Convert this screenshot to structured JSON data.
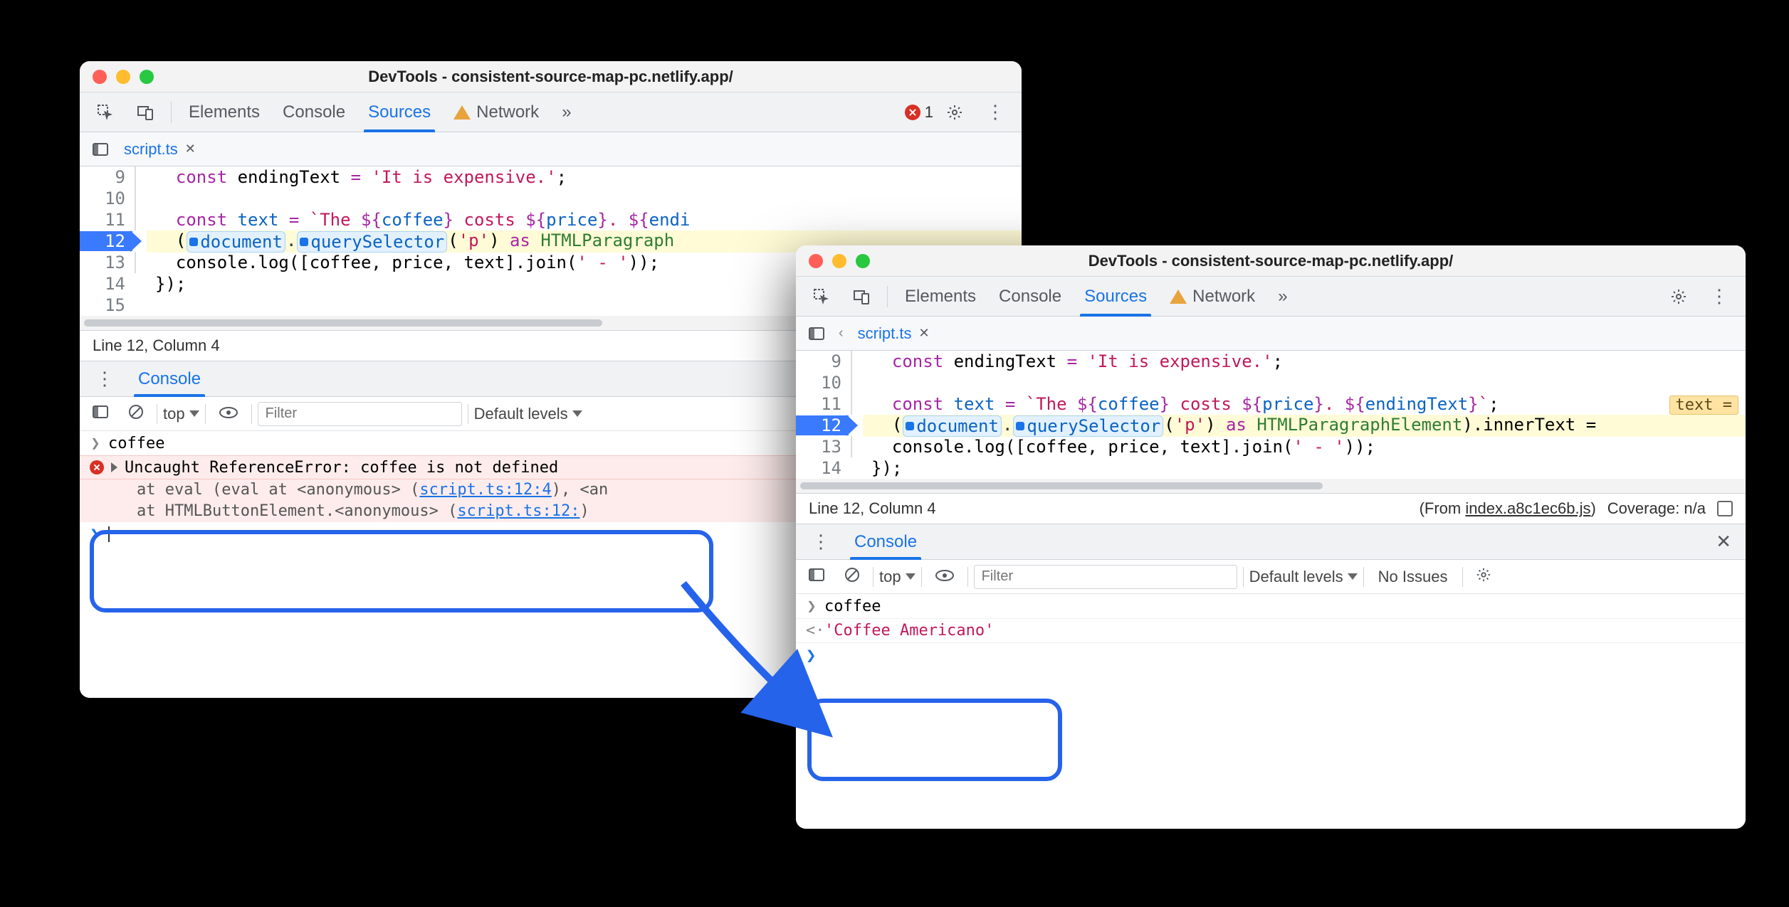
{
  "window_title": "DevTools - consistent-source-map-pc.netlify.app/",
  "tabs": {
    "elements": "Elements",
    "console": "Console",
    "sources": "Sources",
    "network": "Network"
  },
  "error_count": "1",
  "file_tab": "script.ts",
  "left_code": {
    "lines": [
      "9",
      "10",
      "11",
      "12",
      "13",
      "14",
      "15"
    ],
    "l9": "  const endingText = 'It is expensive.';",
    "l10": "",
    "l11_pre": "  const ",
    "l11_var": "text",
    "l11_mid": " = ",
    "l11_tpl": "`The ${coffee} costs ${price}. ${endi",
    "l12_open": "  (",
    "l12_doc": "document",
    "l12_qs": "querySelector",
    "l12_arg": "'p'",
    "l12_as": " as ",
    "l12_type": "HTMLParagraph",
    "l13": "  console.log([coffee, price, text].join(' - '));",
    "l14": "});",
    "l15": ""
  },
  "right_code": {
    "lines": [
      "9",
      "10",
      "11",
      "12",
      "13",
      "14"
    ],
    "l9": "  const endingText = 'It is expensive.';",
    "l10": "",
    "l11_pre": "  const ",
    "l11_var": "text",
    "l11_mid": " = ",
    "l11_tpl": "`The ${coffee} costs ${price}. ${endingText}`",
    "l11_badge": "text =",
    "l12_open": "  (",
    "l12_doc": "document",
    "l12_qs": "querySelector",
    "l12_arg": "'p'",
    "l12_as": " as ",
    "l12_type": "HTMLParagraphElement",
    "l12_tail": ").innerText =",
    "l13": "  console.log([coffee, price, text].join(' - '));",
    "l14": "});"
  },
  "status": {
    "pos": "Line 12, Column 4",
    "from_prefix": "(From ",
    "from_link": "index.a8c1ec6b.js",
    "from_suffix_left": ")",
    "coverage": "Coverage: n/a"
  },
  "drawer": {
    "console": "Console",
    "top": "top",
    "filter_ph": "Filter",
    "levels": "Default levels",
    "no_issues": "No Issues"
  },
  "left_console": {
    "input": "coffee",
    "error": "Uncaught ReferenceError: coffee is not defined",
    "trace1_pre": "at eval (eval at <anonymous> (",
    "trace1_link": "script.ts:12:4",
    "trace1_post": "), <an",
    "trace2_pre": "at HTMLButtonElement.<anonymous> (",
    "trace2_link": "script.ts:12:",
    "trace2_post": ")"
  },
  "right_console": {
    "input": "coffee",
    "result": "'Coffee Americano'"
  }
}
